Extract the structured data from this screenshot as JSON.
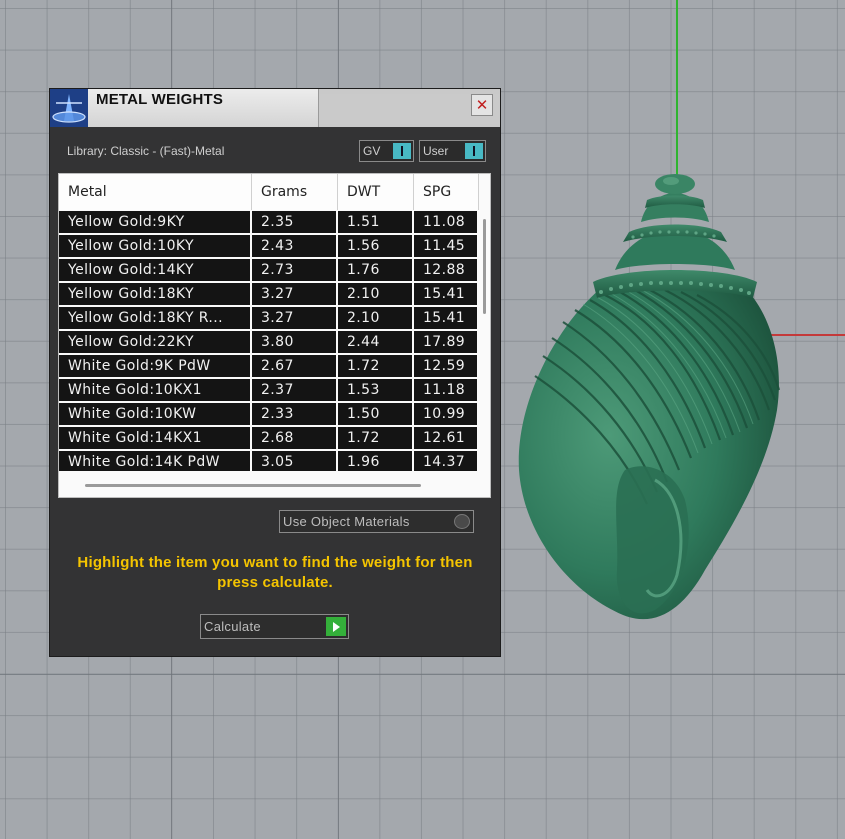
{
  "window": {
    "title": "METAL WEIGHTS",
    "close_glyph": "✕",
    "icon": "scale-icon"
  },
  "library_label": "Library: Classic - (Fast)-Metal",
  "toggles": [
    {
      "label": "GV",
      "on": true
    },
    {
      "label": "User",
      "on": true
    }
  ],
  "table": {
    "columns": [
      "Metal",
      "Grams",
      "DWT",
      "SPG"
    ],
    "rows": [
      [
        "Yellow Gold:9KY",
        "2.35",
        "1.51",
        "11.08"
      ],
      [
        "Yellow Gold:10KY",
        "2.43",
        "1.56",
        "11.45"
      ],
      [
        "Yellow Gold:14KY",
        "2.73",
        "1.76",
        "12.88"
      ],
      [
        "Yellow Gold:18KY",
        "3.27",
        "2.10",
        "15.41"
      ],
      [
        "Yellow Gold:18KY R...",
        "3.27",
        "2.10",
        "15.41"
      ],
      [
        "Yellow Gold:22KY",
        "3.80",
        "2.44",
        "17.89"
      ],
      [
        "White Gold:9K PdW",
        "2.67",
        "1.72",
        "12.59"
      ],
      [
        "White Gold:10KX1",
        "2.37",
        "1.53",
        "11.18"
      ],
      [
        "White Gold:10KW",
        "2.33",
        "1.50",
        "10.99"
      ],
      [
        "White Gold:14KX1",
        "2.68",
        "1.72",
        "12.61"
      ],
      [
        "White Gold:14K PdW",
        "3.05",
        "1.96",
        "14.37"
      ]
    ]
  },
  "use_object_materials_label": "Use Object Materials",
  "instruction": "Highlight the item you want to find the weight for then press calculate.",
  "calculate_label": "Calculate",
  "colors": {
    "viewport_bg": "#a4a8ad",
    "accent_cyan": "#48b9c4",
    "accent_green": "#34b03a",
    "instruction_yellow": "#f4c400",
    "shell_green": "#2f7a5c"
  }
}
